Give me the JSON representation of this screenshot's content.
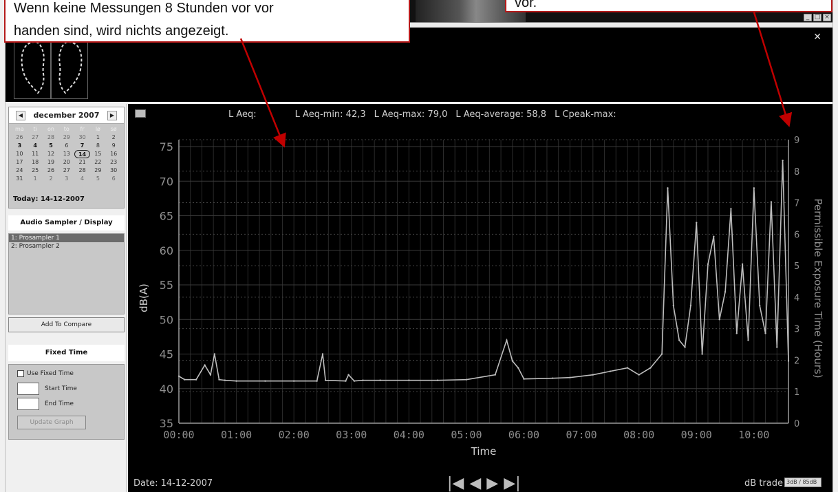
{
  "colors": {
    "chart_bg": "#000000",
    "plot_line": "#bdbdbd",
    "grid": "#2a2a2a",
    "callout_border": "#b51a1a",
    "arrow": "#c00000"
  },
  "window_buttons": {
    "minimize": "_",
    "restore": "□",
    "close": "×"
  },
  "header": {
    "close_glyph": "✕"
  },
  "calendar": {
    "prev": "◀",
    "next": "▶",
    "month_label": "december 2007",
    "weekday_headers": [
      "ma",
      "ti",
      "on",
      "to",
      "fr",
      "lø",
      "sø"
    ],
    "weeks": [
      [
        "26",
        "27",
        "28",
        "29",
        "30",
        "1",
        "2"
      ],
      [
        "3",
        "4",
        "5",
        "6",
        "7",
        "8",
        "9"
      ],
      [
        "10",
        "11",
        "12",
        "13",
        "14",
        "15",
        "16"
      ],
      [
        "17",
        "18",
        "19",
        "20",
        "21",
        "22",
        "23"
      ],
      [
        "24",
        "25",
        "26",
        "27",
        "28",
        "29",
        "30"
      ],
      [
        "31",
        "1",
        "2",
        "3",
        "4",
        "5",
        "6"
      ]
    ],
    "today_label": "Today: 14-12-2007"
  },
  "sampler": {
    "title": "Audio Sampler / Display",
    "items": [
      "1: Prosampler 1",
      "2: Prosampler 2"
    ],
    "add_to_compare": "Add To Compare"
  },
  "fixed_time": {
    "title": "Fixed Time",
    "use_label": "Use Fixed Time",
    "start_label": "Start Time",
    "end_label": "End Time",
    "update_button": "Update Graph"
  },
  "summary": {
    "laeq": "L Aeq:",
    "laeq_min": "L Aeq-min: 42,3",
    "laeq_max": "L Aeq-max: 79,0",
    "laeq_avg": "L Aeq-average: 58,8",
    "lcpeak_max": "L Cpeak-max:"
  },
  "footer": {
    "date": "Date: 14-12-2007",
    "transport": {
      "first": "|◀",
      "prev": "◀",
      "next": "▶",
      "last": "▶|"
    },
    "db_trade_label": "dB trade",
    "db_trade_value": "3dB / 85dB"
  },
  "callouts": {
    "left_lines": [
      "Wenn keine Messungen 8 Stunden vor vor",
      "handen sind, wird nichts angezeigt."
    ],
    "right": "vor."
  },
  "chart_data": {
    "type": "line",
    "xlabel": "Time",
    "ylabel": "dB(A)",
    "y2label": "Permissible Exposure Time (Hours)",
    "x_ticks": [
      "00:00",
      "01:00",
      "02:00",
      "03:00",
      "04:00",
      "05:00",
      "06:00",
      "07:00",
      "08:00",
      "09:00",
      "10:00"
    ],
    "xlim": [
      0,
      10.6
    ],
    "ylim": [
      35,
      76
    ],
    "y_ticks": [
      35,
      40,
      45,
      50,
      55,
      60,
      65,
      70,
      75
    ],
    "y2lim": [
      0,
      9
    ],
    "y2_ticks": [
      0,
      1,
      2,
      3,
      4,
      5,
      6,
      7,
      8,
      9
    ],
    "grid": true,
    "series": [
      {
        "x": [
          0.0,
          0.1,
          0.3,
          0.45,
          0.55,
          0.62,
          0.7,
          0.8,
          1.0,
          1.5,
          2.0,
          2.4,
          2.5,
          2.55,
          2.9,
          2.95,
          3.05,
          3.2,
          3.5,
          4.0,
          4.5,
          5.0,
          5.5,
          5.7,
          5.8,
          5.9,
          6.0,
          6.5,
          6.8,
          7.2,
          7.5,
          7.8,
          8.0,
          8.2,
          8.4,
          8.5,
          8.6,
          8.7,
          8.8,
          8.9,
          9.0,
          9.1,
          9.2,
          9.3,
          9.4,
          9.5,
          9.6,
          9.7,
          9.8,
          9.9,
          10.0,
          10.1,
          10.2,
          10.3,
          10.4,
          10.5,
          10.6
        ],
        "y": [
          41.8,
          41.3,
          41.3,
          43.4,
          42.0,
          45.0,
          41.3,
          41.2,
          41.1,
          41.1,
          41.1,
          41.1,
          45.0,
          41.2,
          41.1,
          42.0,
          41.1,
          41.2,
          41.2,
          41.2,
          41.2,
          41.3,
          42.0,
          47.0,
          44.0,
          43.0,
          41.4,
          41.5,
          41.6,
          42.0,
          42.5,
          43.0,
          42.0,
          43.0,
          45.0,
          69.0,
          52.0,
          47.0,
          46.0,
          52.0,
          64.0,
          45.0,
          58.0,
          62.0,
          50.0,
          54.0,
          66.0,
          48.0,
          58.0,
          47.0,
          69.0,
          52.0,
          48.0,
          67.0,
          46.0,
          73.0,
          44.0
        ]
      }
    ]
  }
}
